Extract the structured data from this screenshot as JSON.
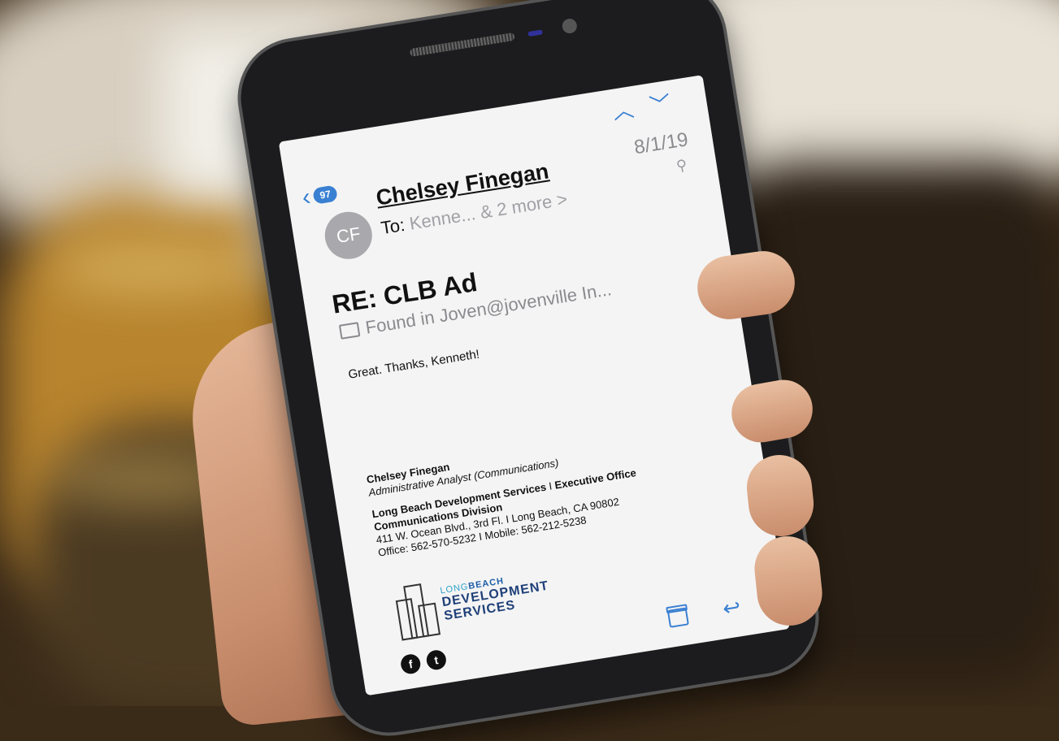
{
  "header": {
    "unread_count": "97",
    "nav_up": "︿",
    "nav_down": "﹀"
  },
  "message": {
    "avatar_initials": "CF",
    "sender": "Chelsey Finegan",
    "date": "8/1/19",
    "to_label": "To:",
    "to_value": "Kenne... & 2 more >",
    "subject": "RE: CLB Ad",
    "found_in": "Found in Joven@jovenville In...",
    "body": "Great.  Thanks, Kenneth!"
  },
  "signature": {
    "name": "Chelsey Finegan",
    "role": "Administrative Analyst (Communications)",
    "org": "Long Beach Development Services",
    "org_sep": " I ",
    "office": "Executive Office",
    "division": "Communications Division",
    "address": "411 W. Ocean Blvd., 3rd Fl.  I  Long Beach, CA 90802",
    "phones": "Office:  562-570-5232  I  Mobile: 562-212-5238"
  },
  "logo": {
    "long": "LONG",
    "beach": "BEACH",
    "line1": "DEVELOPMENT",
    "line2": "SERVICES"
  },
  "colors": {
    "accent": "#3a80d2",
    "logo_blue": "#1e3f78"
  }
}
